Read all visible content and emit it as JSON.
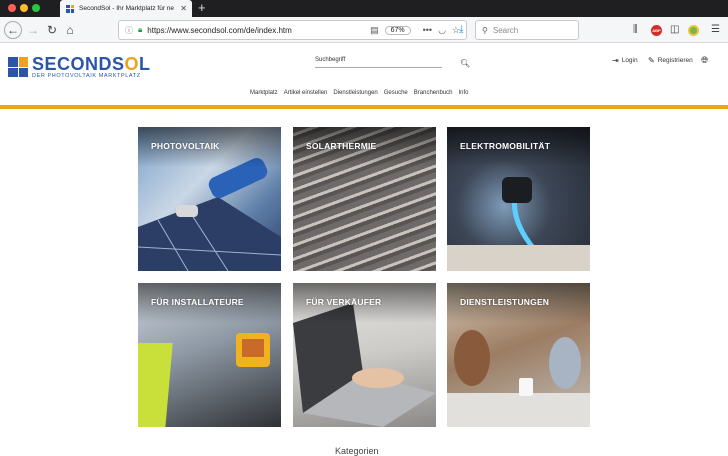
{
  "browser": {
    "tab_title": "SecondSol - Ihr Marktplatz für ne",
    "new_tab": "+",
    "url": "https://www.secondsol.com/de/index.htm",
    "zoom": "67%",
    "search_placeholder": "Search",
    "url_actions": "•••"
  },
  "header": {
    "logo_second": "SECOND",
    "logo_s": "S",
    "logo_o": "O",
    "logo_l": "L",
    "logo_tag": "DER PHOTOVOLTAIK MARKTPLATZ",
    "search_label": "Suchbegriff",
    "login": "Login",
    "register": "Registrieren"
  },
  "nav": [
    "Marktplatz",
    "Artikel einstellen",
    "Dienstleistungen",
    "Gesuche",
    "Branchenbuch",
    "Info"
  ],
  "tiles": [
    "PHOTOVOLTAIK",
    "SOLARTHERMIE",
    "ELEKTROMOBILITÄT",
    "FÜR INSTALLATEURE",
    "FÜR VERKÄUFER",
    "DIENSTLEISTUNGEN"
  ],
  "bottom_partial": "Kategorien",
  "colors": {
    "brand_blue": "#2b56a8",
    "brand_orange": "#f2a21a"
  }
}
